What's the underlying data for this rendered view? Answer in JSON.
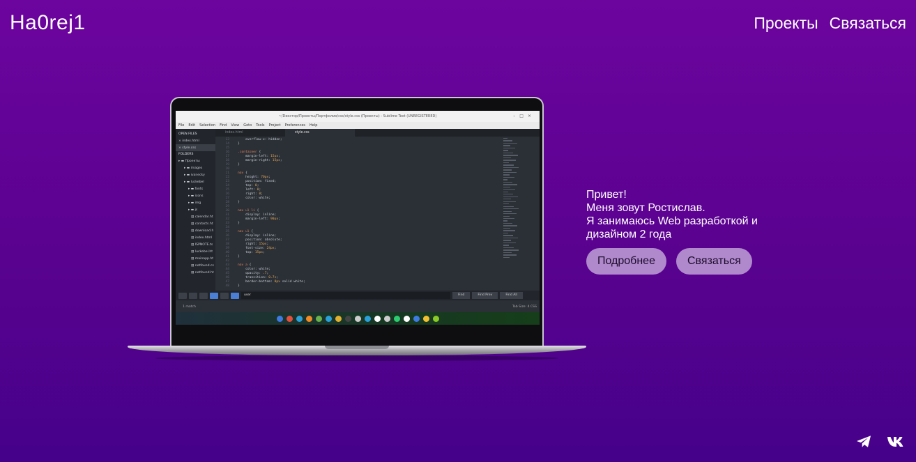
{
  "header": {
    "logo": "Ha0rej1",
    "nav": [
      "Проекты",
      "Связаться"
    ]
  },
  "intro": {
    "lines": [
      "Привет!",
      "Меня зовут Ростислав.",
      "Я занимаюсь Web разработкой и дизайном 2 года"
    ],
    "buttons": [
      "Подробнее",
      "Связаться"
    ]
  },
  "laptop_screen": {
    "window_title": "~/Dекстор/Проекты/Портфолио/css/style.css (Проекты) - Sublime Text (UNREGISTERED)",
    "menu": [
      "File",
      "Edit",
      "Selection",
      "Find",
      "View",
      "Goto",
      "Tools",
      "Project",
      "Preferences",
      "Help"
    ],
    "sidebar": {
      "open_files_header": "OPEN FILES",
      "open_files": [
        "index.html",
        "style.css"
      ],
      "folders_header": "FOLDERS",
      "folders": [
        "Проекты",
        "images",
        "ivanecky",
        "luckebel",
        "fonts",
        "icons",
        "img",
        "js",
        "calendar.ht",
        "contacts.ht",
        "download.h",
        "index.html",
        "ISPNOTE.ts",
        "luckebel.ht",
        "mainapp.ht",
        "notfound.cs",
        "notfound.ht"
      ]
    },
    "tabs": [
      "index.html",
      "style.css"
    ],
    "code_lines": [
      {
        "n": "13",
        "parts": [
          [
            "prop",
            "    overflow-x: hidden;"
          ]
        ]
      },
      {
        "n": "14",
        "parts": [
          [
            "prop",
            "}"
          ]
        ]
      },
      {
        "n": "15",
        "parts": [
          [
            "prop",
            ""
          ]
        ]
      },
      {
        "n": "16",
        "parts": [
          [
            "sel",
            ".container"
          ],
          [
            "prop",
            " {"
          ]
        ]
      },
      {
        "n": "17",
        "parts": [
          [
            "prop",
            "    margin-left: "
          ],
          [
            "val",
            "15px"
          ],
          [
            "prop",
            ";"
          ]
        ]
      },
      {
        "n": "18",
        "parts": [
          [
            "prop",
            "    margin-right: "
          ],
          [
            "val",
            "15px"
          ],
          [
            "prop",
            ";"
          ]
        ]
      },
      {
        "n": "19",
        "parts": [
          [
            "prop",
            "}"
          ]
        ]
      },
      {
        "n": "20",
        "parts": [
          [
            "prop",
            ""
          ]
        ]
      },
      {
        "n": "21",
        "parts": [
          [
            "sel",
            "nav"
          ],
          [
            "prop",
            " {"
          ]
        ]
      },
      {
        "n": "22",
        "parts": [
          [
            "prop",
            "    height: "
          ],
          [
            "val",
            "70px"
          ],
          [
            "prop",
            ";"
          ]
        ]
      },
      {
        "n": "23",
        "parts": [
          [
            "prop",
            "    position: fixed;"
          ]
        ]
      },
      {
        "n": "24",
        "parts": [
          [
            "prop",
            "    top: "
          ],
          [
            "val",
            "0"
          ],
          [
            "prop",
            ";"
          ]
        ]
      },
      {
        "n": "25",
        "parts": [
          [
            "prop",
            "    left: "
          ],
          [
            "val",
            "0"
          ],
          [
            "prop",
            ";"
          ]
        ]
      },
      {
        "n": "26",
        "parts": [
          [
            "prop",
            "    right: "
          ],
          [
            "val",
            "0"
          ],
          [
            "prop",
            ";"
          ]
        ]
      },
      {
        "n": "27",
        "parts": [
          [
            "prop",
            "    color: white;"
          ]
        ]
      },
      {
        "n": "28",
        "parts": [
          [
            "prop",
            "}"
          ]
        ]
      },
      {
        "n": "29",
        "parts": [
          [
            "prop",
            ""
          ]
        ]
      },
      {
        "n": "30",
        "parts": [
          [
            "sel",
            "nav ul li"
          ],
          [
            "prop",
            " {"
          ]
        ]
      },
      {
        "n": "31",
        "parts": [
          [
            "prop",
            "    display: inline;"
          ]
        ]
      },
      {
        "n": "32",
        "parts": [
          [
            "prop",
            "    margin-left: "
          ],
          [
            "val",
            "90px"
          ],
          [
            "prop",
            ";"
          ]
        ]
      },
      {
        "n": "33",
        "parts": [
          [
            "prop",
            "}"
          ]
        ]
      },
      {
        "n": "34",
        "parts": [
          [
            "prop",
            ""
          ]
        ]
      },
      {
        "n": "35",
        "parts": [
          [
            "sel",
            "nav ul"
          ],
          [
            "prop",
            " {"
          ]
        ]
      },
      {
        "n": "36",
        "parts": [
          [
            "prop",
            "    display: inline;"
          ]
        ]
      },
      {
        "n": "37",
        "parts": [
          [
            "prop",
            "    position: absolute;"
          ]
        ]
      },
      {
        "n": "38",
        "parts": [
          [
            "prop",
            "    right: "
          ],
          [
            "val",
            "15px"
          ],
          [
            "prop",
            ";"
          ]
        ]
      },
      {
        "n": "39",
        "parts": [
          [
            "prop",
            "    font-size: "
          ],
          [
            "val",
            "24px"
          ],
          [
            "prop",
            ";"
          ]
        ]
      },
      {
        "n": "40",
        "parts": [
          [
            "prop",
            "    top: "
          ],
          [
            "val",
            "15px"
          ],
          [
            "prop",
            ";"
          ]
        ]
      },
      {
        "n": "41",
        "parts": [
          [
            "prop",
            "}"
          ]
        ]
      },
      {
        "n": "42",
        "parts": [
          [
            "prop",
            ""
          ]
        ]
      },
      {
        "n": "43",
        "parts": [
          [
            "sel",
            "nav a"
          ],
          [
            "prop",
            " {"
          ]
        ]
      },
      {
        "n": "44",
        "parts": [
          [
            "prop",
            "    color: white;"
          ]
        ]
      },
      {
        "n": "45",
        "parts": [
          [
            "prop",
            "    opacity: "
          ],
          [
            "val",
            ".7"
          ],
          [
            "prop",
            ";"
          ]
        ]
      },
      {
        "n": "46",
        "parts": [
          [
            "prop",
            "    transition: "
          ],
          [
            "val",
            "0.7s"
          ],
          [
            "prop",
            ";"
          ]
        ]
      },
      {
        "n": "47",
        "parts": [
          [
            "prop",
            "    border-bottom: "
          ],
          [
            "val",
            "0px"
          ],
          [
            "prop",
            " solid white;"
          ]
        ]
      },
      {
        "n": "48",
        "parts": [
          [
            "prop",
            "}"
          ]
        ]
      }
    ],
    "find": {
      "query": "user",
      "actions": [
        "Find",
        "Find Prev",
        "Find All"
      ]
    },
    "status_left": "1 match",
    "status_right": "Tab Size: 4      CSS",
    "dock_colors": [
      "#3d7be0",
      "#e0503d",
      "#2aa0d8",
      "#f08a24",
      "#6ab04c",
      "#2aa0d8",
      "#e0b030",
      "#444444",
      "#cccccc",
      "#2aa0d8",
      "#ffffff",
      "#cccccc",
      "#2ecc71",
      "#ffffff",
      "#3d7be0",
      "#f0c030",
      "#8ac926"
    ]
  },
  "social": {
    "telegram_icon": "telegram-icon",
    "vk_icon": "vk-icon"
  }
}
